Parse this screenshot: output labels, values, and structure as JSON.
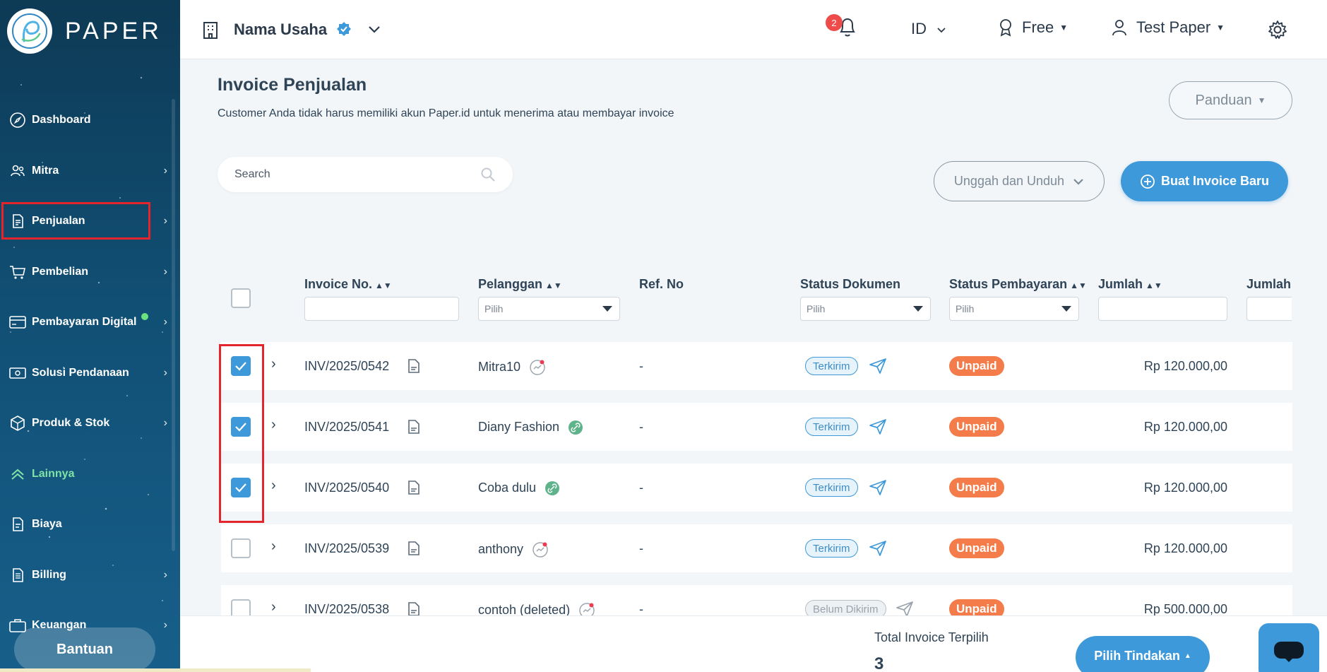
{
  "brand": {
    "name": "PAPER"
  },
  "sidebar": {
    "items": [
      {
        "label": "Dashboard",
        "icon": "compass-icon",
        "chevron": false
      },
      {
        "label": "Mitra",
        "icon": "users-icon",
        "chevron": true
      },
      {
        "label": "Penjualan",
        "icon": "document-icon",
        "chevron": true
      },
      {
        "label": "Pembelian",
        "icon": "cart-icon",
        "chevron": true
      },
      {
        "label": "Pembayaran Digital",
        "icon": "card-icon",
        "chevron": true,
        "dot": true
      },
      {
        "label": "Solusi Pendanaan",
        "icon": "money-icon",
        "chevron": true
      },
      {
        "label": "Produk & Stok",
        "icon": "box-icon",
        "chevron": true
      },
      {
        "label": "Lainnya",
        "icon": "double-chevron-up-icon",
        "chevron": false
      },
      {
        "label": "Biaya",
        "icon": "receipt-icon",
        "chevron": false
      },
      {
        "label": "Billing",
        "icon": "bill-icon",
        "chevron": true
      },
      {
        "label": "Keuangan",
        "icon": "briefcase-icon",
        "chevron": true
      }
    ],
    "help_label": "Bantuan"
  },
  "header": {
    "business_name": "Nama Usaha",
    "notification_count": "2",
    "language": "ID",
    "plan": "Free",
    "user": "Test Paper"
  },
  "page": {
    "title": "Invoice Penjualan",
    "subtitle": "Customer Anda tidak harus memiliki akun Paper.id untuk menerima atau membayar invoice",
    "guide_label": "Panduan",
    "search_placeholder": "Search",
    "upload_download_label": "Unggah dan Unduh",
    "new_invoice_label": "Buat Invoice Baru"
  },
  "table": {
    "columns": {
      "invoice_no": "Invoice No.",
      "customer": "Pelanggan",
      "ref_no": "Ref. No",
      "doc_status": "Status Dokumen",
      "pay_status": "Status Pembayaran",
      "amount": "Jumlah",
      "amount_total": "Jumlah T"
    },
    "filter_placeholder": "Pilih",
    "rows": [
      {
        "checked": true,
        "invoice": "INV/2025/0542",
        "customer": "Mitra10",
        "ref": "-",
        "doc_status": "Terkirim",
        "pay_status": "Unpaid",
        "amount": "Rp 120.000,00"
      },
      {
        "checked": true,
        "invoice": "INV/2025/0541",
        "customer": "Diany Fashion",
        "ref": "-",
        "doc_status": "Terkirim",
        "pay_status": "Unpaid",
        "amount": "Rp 120.000,00"
      },
      {
        "checked": true,
        "invoice": "INV/2025/0540",
        "customer": "Coba dulu",
        "ref": "-",
        "doc_status": "Terkirim",
        "pay_status": "Unpaid",
        "amount": "Rp 120.000,00"
      },
      {
        "checked": false,
        "invoice": "INV/2025/0539",
        "customer": "anthony",
        "ref": "-",
        "doc_status": "Terkirim",
        "pay_status": "Unpaid",
        "amount": "Rp 120.000,00"
      },
      {
        "checked": false,
        "invoice": "INV/2025/0538",
        "customer": "contoh (deleted)",
        "ref": "-",
        "doc_status": "Belum Dikirim",
        "pay_status": "Unpaid",
        "amount": "Rp 500.000,00"
      }
    ]
  },
  "footer": {
    "total_label": "Total Invoice Terpilih",
    "total_value": "3",
    "action_label": "Pilih Tindakan"
  },
  "colors": {
    "primary": "#3d99d9",
    "unpaid": "#f47b4a",
    "highlight": "#e5252c",
    "sidebar": "#114f74"
  }
}
